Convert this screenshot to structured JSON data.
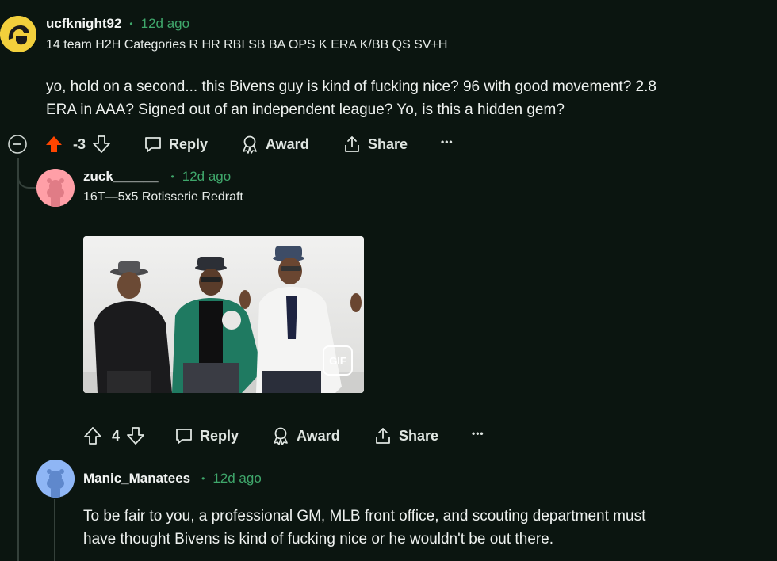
{
  "comments": [
    {
      "username": "ucfknight92",
      "time": "12d ago",
      "flair": "14 team H2H Categories R HR RBI SB BA OPS K ERA K/BB QS SV+H",
      "body_lines": [
        "yo, hold on a second... this Bivens guy is kind of fucking nice? 96 with good movement? 2.8",
        "ERA in AAA? Signed out of an independent league? Yo, is this a hidden gem?"
      ],
      "score": "-3",
      "upvoted": true
    },
    {
      "username": "zuck______",
      "time": "12d ago",
      "flair": "16T—5x5 Rotisserie Redraft",
      "gif_badge": "GIF",
      "score": "4"
    },
    {
      "username": "Manic_Manatees",
      "time": "12d ago",
      "body_lines": [
        "To be fair to you, a professional GM, MLB front office, and scouting department must",
        "have thought Bivens is kind of fucking nice or he wouldn't be out there."
      ]
    }
  ],
  "actions": {
    "reply": "Reply",
    "award": "Award",
    "share": "Share",
    "more": "•••"
  },
  "colors": {
    "background": "#0b1510",
    "upvote_active": "#ff4500",
    "timestamp": "#3fa76b",
    "zuck_avatar": "#ff9fa7",
    "manatee_avatar": "#8fb6f5"
  }
}
